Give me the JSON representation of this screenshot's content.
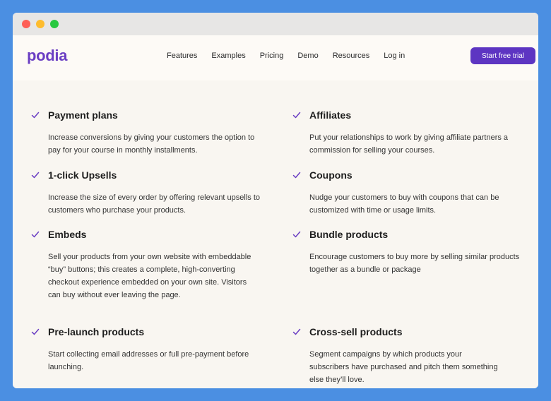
{
  "logo": "podia",
  "nav": {
    "links": [
      "Features",
      "Examples",
      "Pricing",
      "Demo",
      "Resources",
      "Log in"
    ],
    "cta": "Start free trial"
  },
  "features": [
    {
      "title": "Payment plans",
      "desc": "Increase conversions by giving your customers the option to pay for your course in monthly installments."
    },
    {
      "title": "Affiliates",
      "desc": "Put your relationships to work by giving affiliate partners a commission for selling your courses."
    },
    {
      "title": "1-click Upsells",
      "desc": "Increase the size of every order by offering relevant upsells to customers who purchase your products."
    },
    {
      "title": "Coupons",
      "desc": "Nudge your customers to buy with coupons that can be customized with time or usage limits."
    },
    {
      "title": "Embeds",
      "desc": "Sell your products from your own website with embeddable “buy” buttons; this creates a complete, high-converting checkout experience embedded on your own site. Visitors can buy without ever leaving the page."
    },
    {
      "title": "Bundle products",
      "desc": "Encourage customers to buy more by selling similar products together as a bundle or package"
    },
    {
      "title": "Pre-launch products",
      "desc": "Start collecting email addresses or full pre-payment before launching."
    },
    {
      "title": "Cross-sell products",
      "desc": "Segment campaigns by which products your subscribers have purchased and pitch them something else they’ll love."
    }
  ],
  "colors": {
    "accent": "#5d35c2",
    "check": "#6a3ec3"
  }
}
